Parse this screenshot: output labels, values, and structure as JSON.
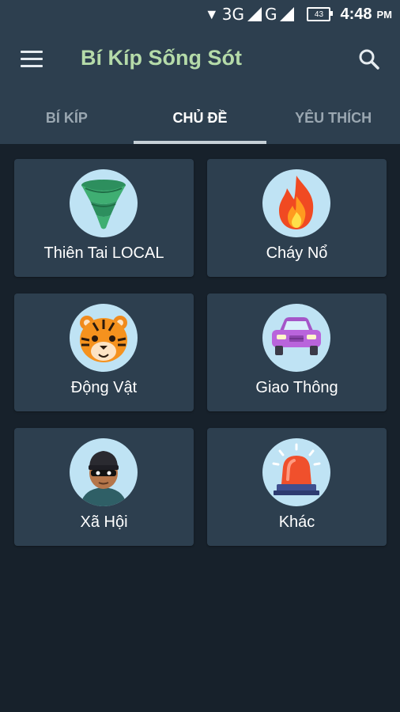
{
  "status_bar": {
    "network_1": "3G",
    "network_2": "G",
    "battery": "43",
    "time": "4:48",
    "ampm": "PM"
  },
  "app_bar": {
    "title": "Bí Kíp Sống Sót"
  },
  "tabs": [
    {
      "label": "BÍ KÍP",
      "active": false
    },
    {
      "label": "CHỦ ĐỀ",
      "active": true
    },
    {
      "label": "YÊU THÍCH",
      "active": false
    }
  ],
  "categories": [
    {
      "label": "Thiên Tai LOCAL",
      "icon": "tornado-icon"
    },
    {
      "label": "Cháy Nổ",
      "icon": "fire-icon"
    },
    {
      "label": "Động Vật",
      "icon": "tiger-icon"
    },
    {
      "label": "Giao Thông",
      "icon": "car-icon"
    },
    {
      "label": "Xã Hội",
      "icon": "thief-icon"
    },
    {
      "label": "Khác",
      "icon": "siren-icon"
    }
  ],
  "colors": {
    "background": "#17212b",
    "bar": "#2d3f4f",
    "title": "#b5dba9",
    "icon_circle": "#bfe3f4"
  }
}
